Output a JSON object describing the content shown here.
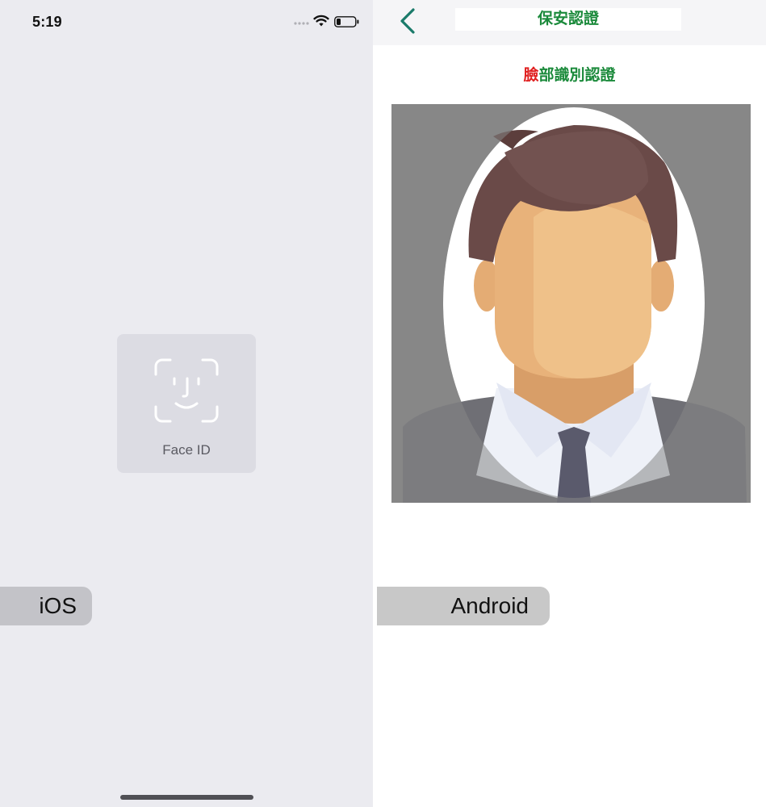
{
  "ios": {
    "status_bar": {
      "time": "5:19",
      "icons": [
        "cellular-dots-icon",
        "wifi-icon",
        "battery-low-icon"
      ]
    },
    "face_id": {
      "icon": "face-id-icon",
      "label": "Face ID"
    },
    "platform_label": "iOS"
  },
  "android": {
    "header": {
      "back_icon": "chevron-left-icon",
      "title": "保安認證"
    },
    "subtitle": {
      "first_char": "臉",
      "rest": "部識別認證"
    },
    "face_frame": {
      "image": "avatar-placeholder-face-oval"
    },
    "platform_label": "Android"
  },
  "colors": {
    "ios_background": "#ebebf0",
    "android_accent": "#1b8a3b",
    "subtitle_highlight": "#e02020",
    "back_chevron": "#1a7a6a",
    "label_tag": "#c8c8c8"
  }
}
